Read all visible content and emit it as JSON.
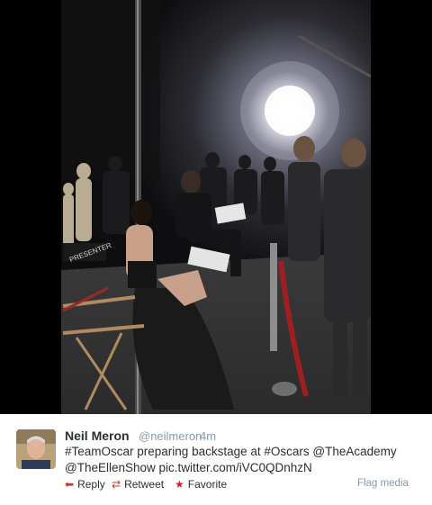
{
  "tweet": {
    "author_name": "Neil Meron",
    "author_handle": "@neilmeron",
    "separator": "·",
    "timestamp": "4m",
    "text_line1": "#TeamOscar preparing backstage at #Oscars @TheAcademy",
    "text_line2": "@TheEllenShow pic.twitter.com/iVC0QDnhzN"
  },
  "actions": {
    "reply": "Reply",
    "retweet": "Retweet",
    "favorite": "Favorite",
    "flag": "Flag media"
  },
  "media": {
    "chair_text": "PRESENTER"
  },
  "colors": {
    "action_accent": "#c0392b",
    "favorite_star": "#d81f1f",
    "muted_text": "#8899a6",
    "body_text": "#292f33"
  },
  "icons": {
    "reply": "reply-arrow-icon",
    "retweet": "retweet-icon",
    "favorite": "star-icon"
  }
}
